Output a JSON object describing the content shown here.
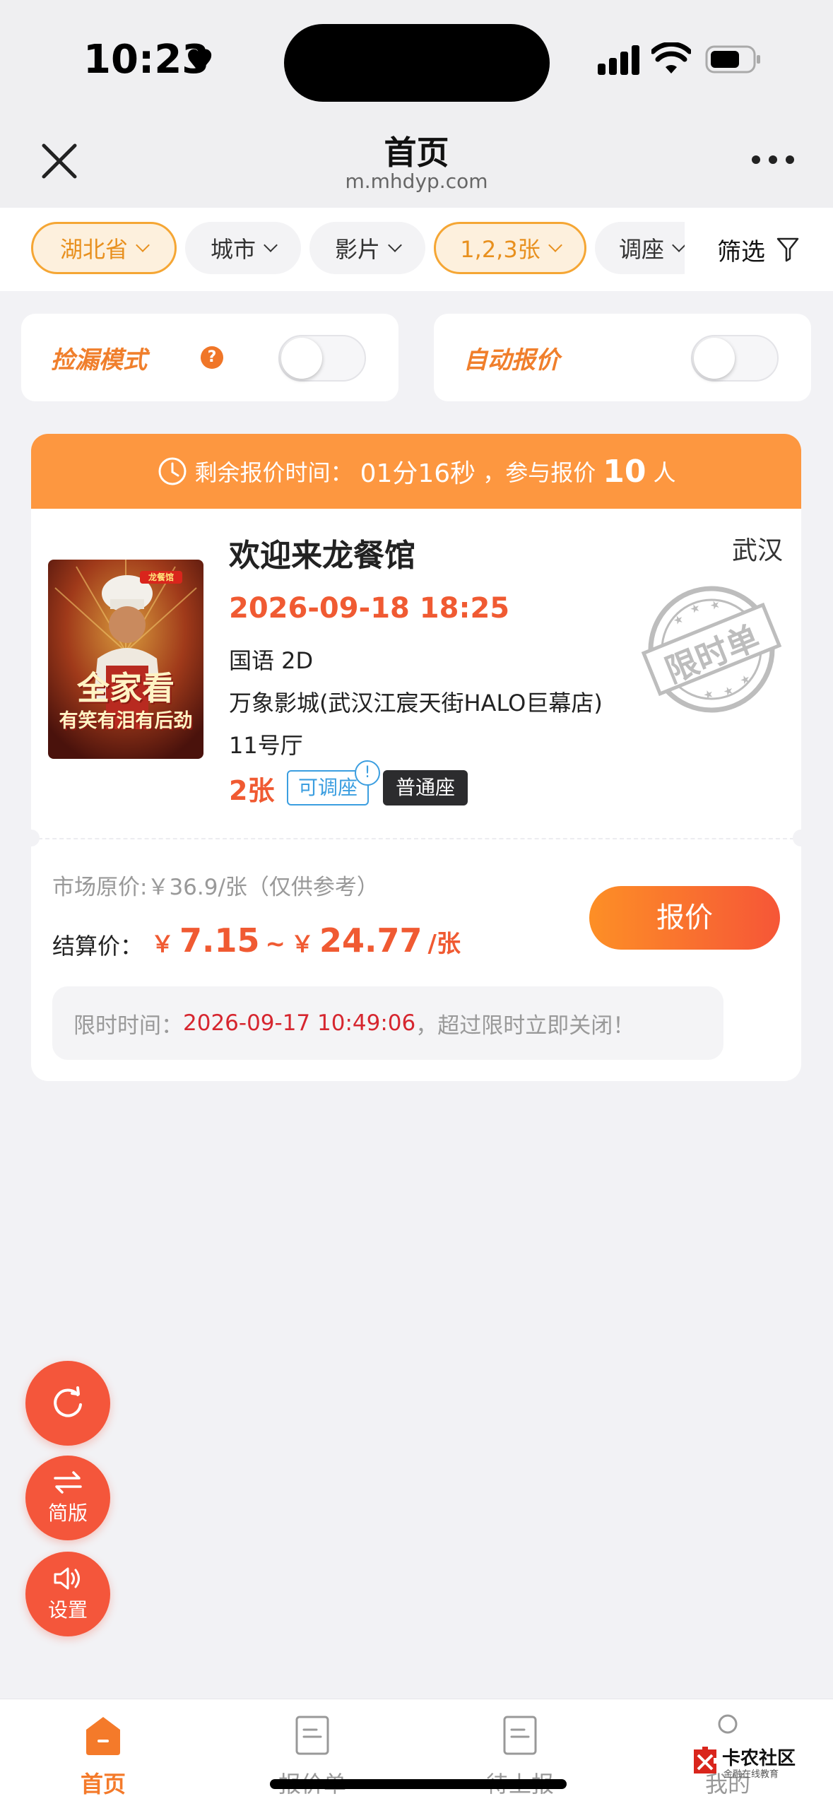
{
  "status_bar": {
    "time": "10:23"
  },
  "nav": {
    "title": "首页",
    "url": "m.mhdyp.com"
  },
  "filters": {
    "chips": [
      {
        "label": "湖北省",
        "active": true
      },
      {
        "label": "城市",
        "active": false
      },
      {
        "label": "影片",
        "active": false
      },
      {
        "label": "1,2,3张",
        "active": true
      },
      {
        "label": "调座",
        "active": false
      }
    ],
    "filter_label": "筛选"
  },
  "toggles": {
    "leak_mode": {
      "label": "捡漏模式",
      "help": "?",
      "on": false
    },
    "auto_quote": {
      "label": "自动报价",
      "on": false
    }
  },
  "order": {
    "banner": {
      "prefix": "剩余报价时间：",
      "time": "01分16秒",
      "mid": "，参与报价",
      "count": "10",
      "suffix": "人"
    },
    "movie_title": "欢迎来龙餐馆",
    "city": "武汉",
    "datetime": "2026-09-18 18:25",
    "language_format": "国语 2D",
    "cinema": "万象影城(武汉江宸天街HALO巨幕店)",
    "hall": "11号厅",
    "ticket_count": "2张",
    "tag_adjustable": "可调座",
    "tag_adjustable_badge": "!",
    "tag_seat": "普通座",
    "stamp_text": "限时单",
    "poster": {
      "top_badge": "龙餐馆",
      "line1": "全家看",
      "line2": "有笑有泪有后劲"
    },
    "market_price": "市场原价:￥36.9/张（仅供参考）",
    "settle_label": "结算价：",
    "settle_currency": "￥",
    "settle_min": "7.15",
    "settle_sep": "~",
    "settle_max": "24.77",
    "settle_unit": "/张",
    "quote_button": "报价",
    "limit": {
      "label": "限时时间：",
      "time": "2026-09-17 10:49:06",
      "suffix": "，超过限时立即关闭！"
    }
  },
  "fabs": {
    "refresh_label": "",
    "simple_label": "简版",
    "settings_label": "设置"
  },
  "tabs": [
    {
      "label": "首页",
      "icon": "home-icon",
      "active": true
    },
    {
      "label": "报价单",
      "icon": "document-icon",
      "active": false
    },
    {
      "label": "待上报",
      "icon": "document-icon",
      "active": false
    },
    {
      "label": "我的",
      "icon": "user-icon",
      "active": false
    }
  ],
  "watermark": {
    "title": "卡农社区",
    "sub": "金融在线教育"
  },
  "colors": {
    "accent": "#f47a2a",
    "price_red": "#f05a32",
    "banner": "#fd9740",
    "chip_active": "#f5a634"
  }
}
